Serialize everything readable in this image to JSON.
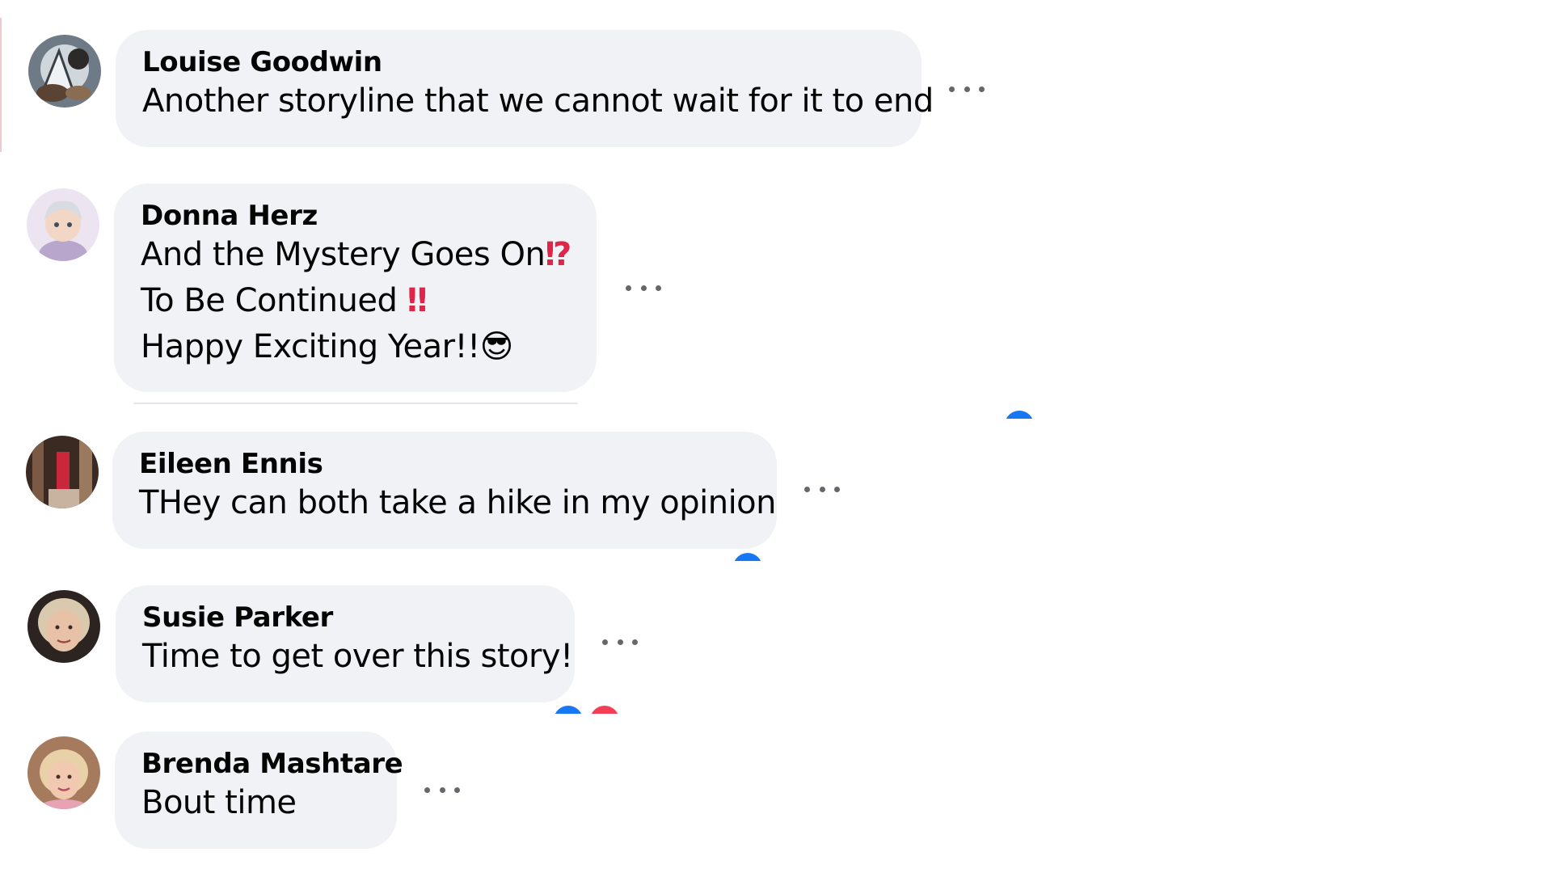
{
  "comments": [
    {
      "author": "Louise Goodwin",
      "lines": [
        "Another storyline that we cannot wait for it to end"
      ]
    },
    {
      "author": "Donna Herz",
      "lines": [
        "And the Mystery Goes On",
        "To Be Continued ",
        "Happy Exciting Year!!"
      ],
      "emoji": [
        "⁉",
        "‼",
        "😎"
      ]
    },
    {
      "author": "Eileen Ennis",
      "lines": [
        "THey can both take a hike in my opinion"
      ]
    },
    {
      "author": "Susie Parker",
      "lines": [
        "Time to get over this story!"
      ]
    },
    {
      "author": "Brenda Mashtare",
      "lines": [
        "Bout time"
      ]
    }
  ],
  "icons": {
    "more": "more-options-icon",
    "avatar": "avatar-photo"
  },
  "colors": {
    "bubble": "#f0f2f5",
    "more_dots": "#65676b",
    "reaction_like": "#1877f2",
    "reaction_love": "#f33e58"
  }
}
